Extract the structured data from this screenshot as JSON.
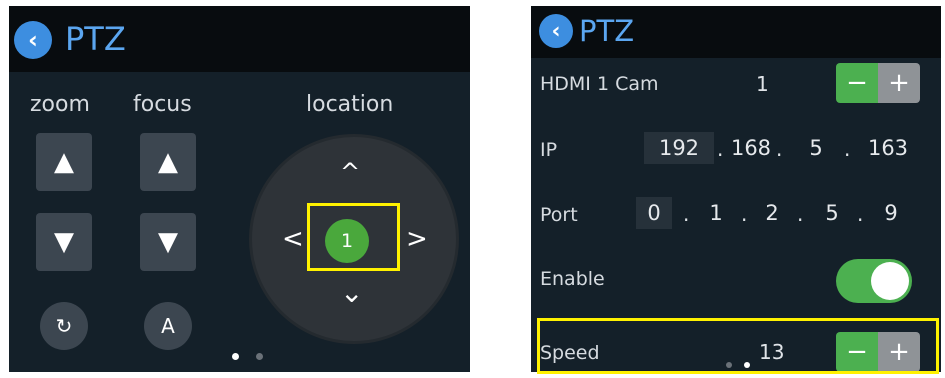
{
  "left": {
    "title": "PTZ",
    "back_icon": "chevron-left-icon",
    "zoom_label": "zoom",
    "focus_label": "focus",
    "location_label": "location",
    "up_glyph": "▲",
    "down_glyph": "▼",
    "reset_glyph": "↻",
    "auto_label": "A",
    "pad_up": "^",
    "pad_down": "⌄",
    "pad_left": "<",
    "pad_right": ">",
    "preset_number": "1",
    "page_index": 1,
    "page_count": 2
  },
  "right": {
    "title": "PTZ",
    "hdmi_label": "HDMI 1 Cam",
    "hdmi_value": "1",
    "ip_label": "IP",
    "ip_parts": [
      "192",
      "168",
      "5",
      "163"
    ],
    "port_label": "Port",
    "port_digits": [
      "0",
      "1",
      "2",
      "5",
      "9"
    ],
    "enable_label": "Enable",
    "enable_on": true,
    "speed_label": "Speed",
    "speed_value": "13",
    "minus_glyph": "−",
    "plus_glyph": "+",
    "dot": "."
  },
  "colors": {
    "accent_blue": "#5ba6f0",
    "green": "#4cb050",
    "highlight": "#fff200",
    "panel_bg": "#142029"
  }
}
